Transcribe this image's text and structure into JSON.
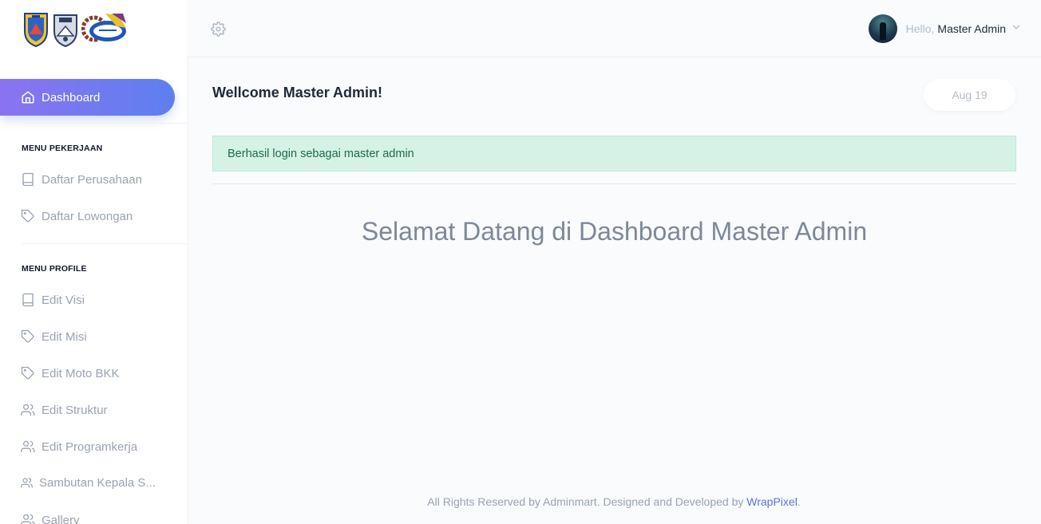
{
  "sidebar": {
    "logos": [
      "provincial-emblem",
      "school-emblem",
      "bkk-logo"
    ],
    "active_item": {
      "label": "Dashboard",
      "icon": "home-icon"
    },
    "sections": [
      {
        "title": "MENU PEKERJAAN",
        "items": [
          {
            "label": "Daftar Perusahaan",
            "icon": "book-icon"
          },
          {
            "label": "Daftar Lowongan",
            "icon": "tag-icon"
          }
        ]
      },
      {
        "title": "MENU PROFILE",
        "items": [
          {
            "label": "Edit Visi",
            "icon": "book-icon"
          },
          {
            "label": "Edit Misi",
            "icon": "tag-icon"
          },
          {
            "label": "Edit Moto BKK",
            "icon": "tag-icon"
          },
          {
            "label": "Edit Struktur",
            "icon": "users-icon"
          },
          {
            "label": "Edit Programkerja",
            "icon": "users-icon"
          },
          {
            "label": "Sambutan Kepala S...",
            "icon": "users-icon"
          },
          {
            "label": "Gallery",
            "icon": "users-icon"
          }
        ]
      }
    ]
  },
  "topbar": {
    "settings_icon": "gear-icon",
    "greeting": "Hello,",
    "user_name": "Master Admin",
    "dropdown_icon": "chevron-down-icon"
  },
  "main": {
    "welcome": "Wellcome Master Admin!",
    "date": "Aug 19",
    "alert": "Berhasil login sebagai master admin",
    "headline": "Selamat Datang di Dashboard Master Admin"
  },
  "footer": {
    "text": "All Rights Reserved by Adminmart. Designed and Developed by ",
    "link": "WrapPixel",
    "end": "."
  },
  "colors": {
    "accent_start": "#8b73f0",
    "accent_end": "#5d7ff0",
    "alert_bg": "#d4f3e6",
    "alert_text": "#1f6a45",
    "link": "#5d6fe0"
  }
}
